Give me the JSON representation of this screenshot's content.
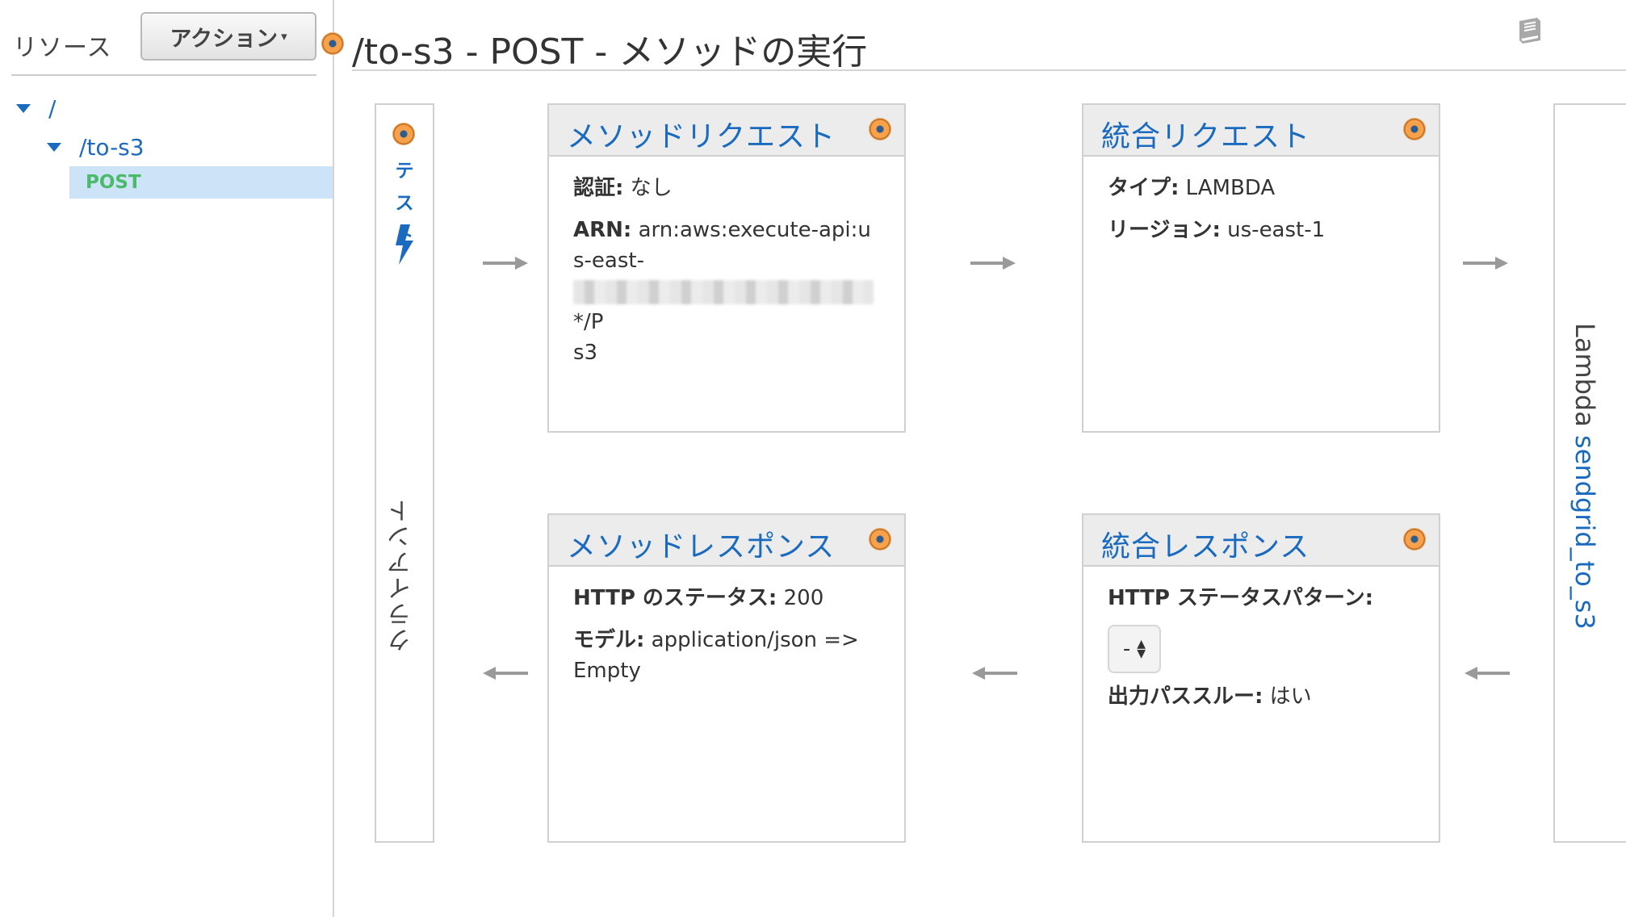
{
  "sidebar": {
    "title": "リソース",
    "actions_label": "アクション",
    "tree": {
      "root": "/",
      "child": "/to-s3",
      "method": "POST"
    }
  },
  "header": {
    "title": "/to-s3 - POST - メソッドの実行"
  },
  "client": {
    "test_label": "テスト",
    "label": "クライアント"
  },
  "method_request": {
    "title": "メソッドリクエスト",
    "auth_label": "認証:",
    "auth_value": "なし",
    "arn_label": "ARN:",
    "arn_value_prefix": "arn:aws:execute-api:us-east-",
    "arn_value_suffix": "*/P",
    "arn_value_end": "s3"
  },
  "integration_request": {
    "title": "統合リクエスト",
    "type_label": "タイプ:",
    "type_value": "LAMBDA",
    "region_label": "リージョン:",
    "region_value": "us-east-1"
  },
  "method_response": {
    "title": "メソッドレスポンス",
    "status_label": "HTTP のステータス:",
    "status_value": "200",
    "model_label": "モデル:",
    "model_value": "application/json => Empty"
  },
  "integration_response": {
    "title": "統合レスポンス",
    "pattern_label": "HTTP ステータスパターン:",
    "pattern_value": "-",
    "passthrough_label": "出力パススルー:",
    "passthrough_value": "はい"
  },
  "lambda": {
    "prefix": "Lambda",
    "function_name": "sendgrid_to_s3"
  },
  "colors": {
    "link": "#1a6bbf",
    "method_green": "#4cba6b",
    "selected_bg": "#cde3f7",
    "status_dot": "#f7a14a"
  }
}
